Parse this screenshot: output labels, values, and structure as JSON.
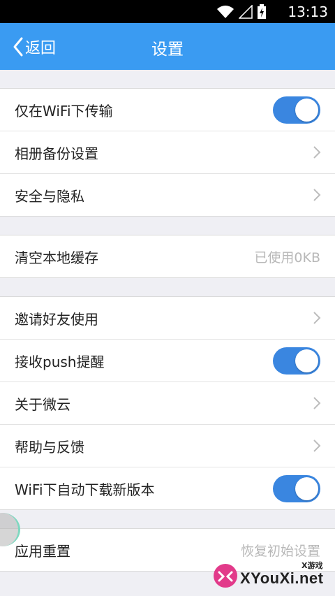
{
  "status_bar": {
    "time": "13:13",
    "icons": [
      "wifi-icon",
      "cell-signal-icon",
      "battery-charging-icon"
    ]
  },
  "header": {
    "back_label": "返回",
    "title": "设置",
    "background_color": "#3a9bf2"
  },
  "settings": {
    "wifi_only": {
      "label": "仅在WiFi下传输",
      "enabled": true
    },
    "album_backup": {
      "label": "相册备份设置"
    },
    "security_privacy": {
      "label": "安全与隐私"
    },
    "clear_cache": {
      "label": "清空本地缓存",
      "value": "已使用0KB"
    },
    "invite_friends": {
      "label": "邀请好友使用"
    },
    "push_notifications": {
      "label": "接收push提醒",
      "enabled": true
    },
    "about": {
      "label": "关于微云"
    },
    "help_feedback": {
      "label": "帮助与反馈"
    },
    "wifi_auto_update": {
      "label": "WiFi下自动下载新版本",
      "enabled": true
    },
    "app_reset": {
      "label": "应用重置",
      "value": "恢复初始设置"
    }
  },
  "watermark": {
    "text": "XYouXi.net",
    "top_text": "X游戏"
  },
  "colors": {
    "accent": "#3a86e0",
    "page_background": "#efeff4"
  }
}
